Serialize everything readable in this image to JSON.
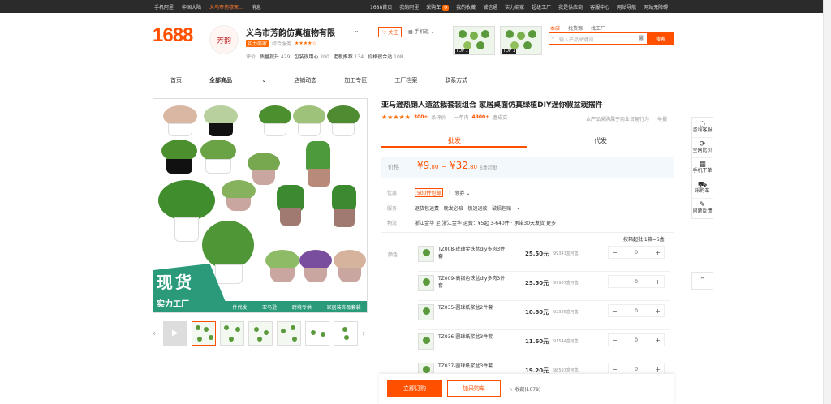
{
  "topbar": {
    "left": [
      "手机阿里",
      "中国大陆",
      "义乌市伤穆宋...",
      "消息"
    ],
    "right": [
      "1688首页",
      "我的阿里",
      "采购车",
      "我的收藏",
      "诚信通",
      "实力商家",
      "超级工厂",
      "我是供应商",
      "客服中心",
      "网站导航",
      "网站无障碍"
    ],
    "badge": "0"
  },
  "logo": "1688",
  "shop": {
    "logo_text": "芳韵",
    "name": "义乌市芳韵仿真植物有限",
    "tag": "实力商家",
    "meta_label": "综合服务",
    "stars": "★★★★☆",
    "scores": [
      {
        "label": "质量提升",
        "value": "429"
      },
      {
        "label": "包装很用心",
        "value": "200"
      },
      {
        "label": "老板推荐",
        "value": "134"
      },
      {
        "label": "价格很合适",
        "value": "108"
      }
    ],
    "score_prefix": "评价",
    "follow": "关注",
    "mobile": "手机逛"
  },
  "ads": [
    "TOP 1",
    "TOP 1"
  ],
  "search": {
    "tabs": [
      "本店",
      "找货源",
      "找工厂"
    ],
    "placeholder": "输入产品关键词",
    "button": "搜索"
  },
  "nav": [
    "首页",
    "全部商品",
    "店铺动态",
    "加工专区",
    "工厂档案",
    "联系方式"
  ],
  "main_image": {
    "big": "现货",
    "small": "实力工厂",
    "strip": [
      "一件代发",
      "亚马逊",
      "跨境专供",
      "家居装饰品套装"
    ]
  },
  "product": {
    "title": "亚马逊热销人造盆栽套装组合 家居桌面仿真绿植DIY迷你假盆栽摆件",
    "rating_stars": "★★★★★",
    "reviews_count": "300+",
    "reviews_label": "条评价",
    "sold_prefix": "一年内",
    "sold_count": "4900+",
    "sold_unit": "盒成交",
    "right_note": "本产品采购属于商业贸易行为",
    "report": "举报"
  },
  "tabs": [
    "批发",
    "代发"
  ],
  "price": {
    "label": "价格",
    "min": "9",
    "min_dec": ".80",
    "sep": "~",
    "max": "32",
    "max_dec": ".80",
    "moq": "6盒起批"
  },
  "rows": {
    "promo_label": "优惠",
    "promo_tag": "500件包邮",
    "promo_more": "领券",
    "service_label": "服务",
    "service_text": "退货包运费 · 晚发必赔 · 极速退款 · 破损包赔",
    "logistics_label": "物流",
    "logistics_text": "浙江金华 至 浙江金华  运费：¥5起   3-640件 · 承诺30天发货  更多"
  },
  "batch_label": "按箱起批 1箱=6盒",
  "color_label": "颜色",
  "skus": [
    {
      "name": "TZ008-玫瑰金铁盆diy多肉3件套",
      "price": "25.50元",
      "stock": "99341盒可售",
      "qty": "0"
    },
    {
      "name": "TZ009-高银色铁盆diy多肉3件套",
      "price": "25.50元",
      "stock": "99937盒可售",
      "qty": "0"
    },
    {
      "name": "TZ035-圆球纸浆盆2件套",
      "price": "10.80元",
      "stock": "92335盒可售",
      "qty": "0"
    },
    {
      "name": "TZ036-圆球纸浆盆3件套",
      "price": "11.60元",
      "stock": "91544盒可售",
      "qty": "0"
    },
    {
      "name": "TZ037-圆球纸浆盆3件套",
      "price": "19.20元",
      "stock": "98597盒可售",
      "qty": "0"
    }
  ],
  "bottom": {
    "buy": "立即订购",
    "cart": "加采购车",
    "fav": "收藏(1079)"
  },
  "side": [
    {
      "icon": "chat-icon",
      "glyph": "◌",
      "label": "咨询客服"
    },
    {
      "icon": "compare-icon",
      "glyph": "⟳",
      "label": "全网比价"
    },
    {
      "icon": "qr-icon",
      "glyph": "▦",
      "label": "手机下单"
    },
    {
      "icon": "cart-icon",
      "glyph": "⛟",
      "label": "采购车"
    },
    {
      "icon": "feedback-icon",
      "glyph": "✎",
      "label": "问题反馈"
    }
  ]
}
